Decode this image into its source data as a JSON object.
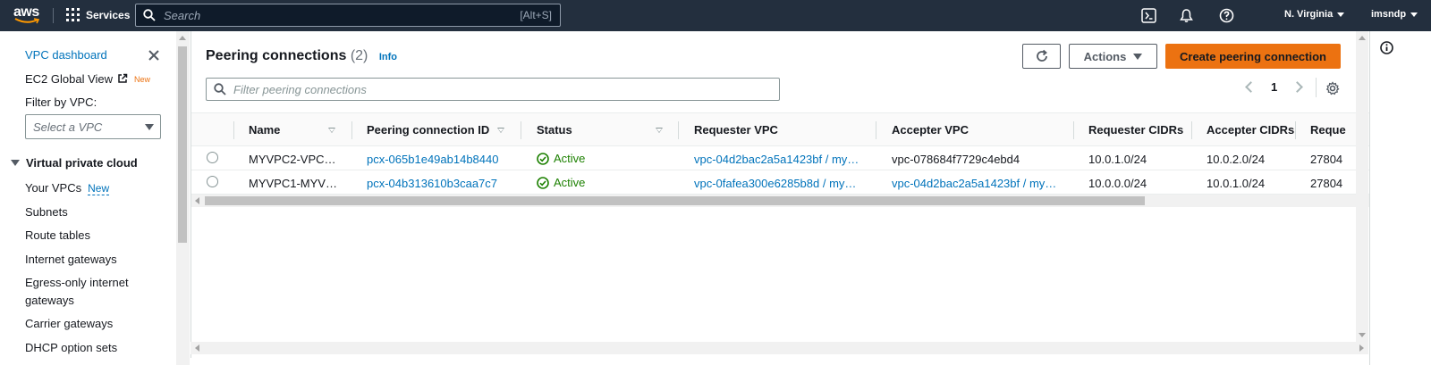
{
  "nav": {
    "logo": "aws",
    "services": "Services",
    "search_placeholder": "Search",
    "search_shortcut": "[Alt+S]",
    "region": "N. Virginia",
    "user": "imsndp"
  },
  "sidebar": {
    "dashboard": "VPC dashboard",
    "ec2_global": "EC2 Global View",
    "ec2_badge": "New",
    "filter_label": "Filter by VPC:",
    "select_placeholder": "Select a VPC",
    "section": "Virtual private cloud",
    "items": [
      {
        "label": "Your VPCs",
        "badge": "New"
      },
      {
        "label": "Subnets"
      },
      {
        "label": "Route tables"
      },
      {
        "label": "Internet gateways"
      },
      {
        "label": "Egress-only internet"
      },
      {
        "label": "gateways"
      },
      {
        "label": "Carrier gateways"
      },
      {
        "label": "DHCP option sets"
      }
    ]
  },
  "main": {
    "title": "Peering connections",
    "count": "(2)",
    "info": "Info",
    "actions": "Actions",
    "create": "Create peering connection",
    "filter_placeholder": "Filter peering connections",
    "page": "1",
    "columns": [
      "Name",
      "Peering connection ID",
      "Status",
      "Requester VPC",
      "Accepter VPC",
      "Requester CIDRs",
      "Accepter CIDRs",
      "Reque"
    ],
    "rows": [
      {
        "name": "MYVPC2-VPC…",
        "id": "pcx-065b1e49ab14b8440",
        "status": "Active",
        "requester": "vpc-04d2bac2a5a1423bf / my…",
        "accepter": "vpc-078684f7729c4ebd4",
        "req_cidr": "10.0.1.0/24",
        "acc_cidr": "10.0.2.0/24",
        "extra": "27804"
      },
      {
        "name": "MYVPC1-MYV…",
        "id": "pcx-04b313610b3caa7c7",
        "status": "Active",
        "requester": "vpc-0fafea300e6285b8d / my…",
        "accepter": "vpc-04d2bac2a5a1423bf / my…",
        "req_cidr": "10.0.0.0/24",
        "acc_cidr": "10.0.1.0/24",
        "extra": "27804"
      }
    ]
  },
  "colors": {
    "nav_bg": "#232f3e",
    "link": "#0073bb",
    "primary": "#ec7211",
    "success": "#1d8102"
  },
  "icons": [
    "aws-logo",
    "grid-icon",
    "search-icon",
    "cloudshell-icon",
    "bell-icon",
    "help-icon",
    "close-icon",
    "external-link-icon",
    "refresh-icon",
    "gear-icon",
    "status-success-icon",
    "info-icon"
  ]
}
